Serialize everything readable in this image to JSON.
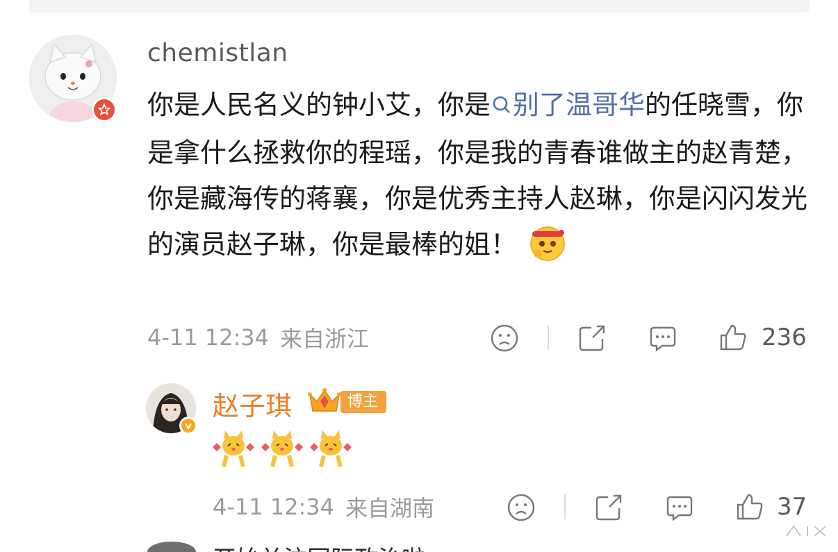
{
  "main_comment": {
    "username": "chemistlan",
    "text_part1": "你是人民名义的钟小艾，你是",
    "topic_link": "别了温哥华",
    "text_part2": "的任晓雪，你是拿什么拯救你的程瑶，你是我的青春谁做主的赵青楚，你是藏海传的蒋襄，你是优秀主持人赵琳，你是闪闪发光的演员赵子琳，你是最棒的姐！",
    "emoji": "hug-emoji",
    "timestamp": "4-11 12:34",
    "location": "来自浙江",
    "like_count": "236",
    "actions": [
      "dislike-icon",
      "share-icon",
      "comment-icon",
      "like-icon"
    ]
  },
  "reply": {
    "username": "赵子琪",
    "badge": "博主",
    "emojis": [
      "dancing-cat-emoji",
      "dancing-cat-emoji",
      "dancing-cat-emoji"
    ],
    "timestamp": "4-11 12:34",
    "location": "来自湖南",
    "like_count": "37"
  },
  "next_comment": {
    "text": "开始关注国际政治啦"
  },
  "colors": {
    "link": "#4f6ea8",
    "reply_name": "#f07c22",
    "badge_bg": "#f5a13c",
    "meta": "#9a9a9a"
  }
}
